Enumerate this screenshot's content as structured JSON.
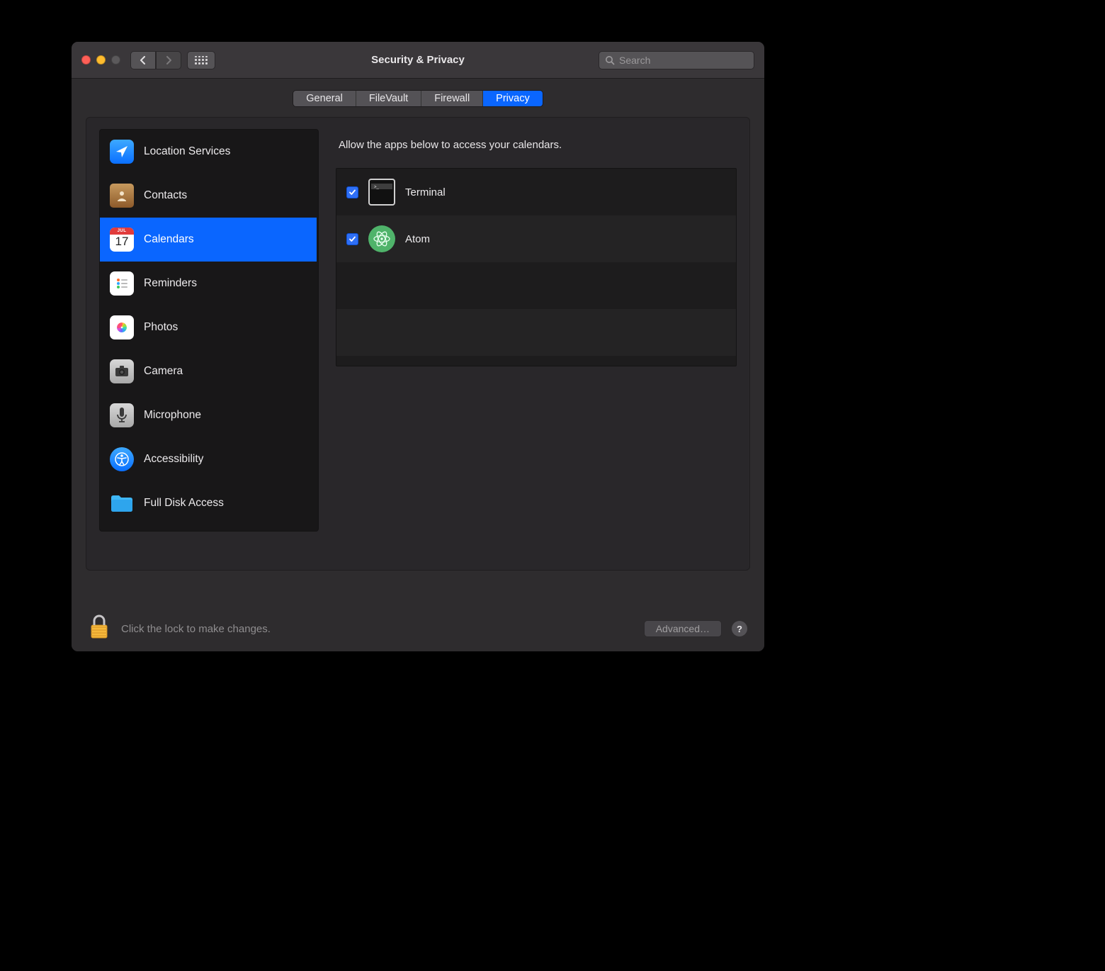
{
  "window_title": "Security & Privacy",
  "search_placeholder": "Search",
  "tabs": {
    "general": "General",
    "filevault": "FileVault",
    "firewall": "Firewall",
    "privacy": "Privacy"
  },
  "active_tab": "privacy",
  "sidebar": {
    "selected_index": 2,
    "items": [
      {
        "label": "Location Services",
        "icon": "location"
      },
      {
        "label": "Contacts",
        "icon": "contacts"
      },
      {
        "label": "Calendars",
        "icon": "calendar",
        "day": "17",
        "month": "JUL"
      },
      {
        "label": "Reminders",
        "icon": "reminders"
      },
      {
        "label": "Photos",
        "icon": "photos"
      },
      {
        "label": "Camera",
        "icon": "camera"
      },
      {
        "label": "Microphone",
        "icon": "microphone"
      },
      {
        "label": "Accessibility",
        "icon": "accessibility"
      },
      {
        "label": "Full Disk Access",
        "icon": "fulldisk"
      }
    ]
  },
  "description": "Allow the apps below to access your calendars.",
  "apps": [
    {
      "label": "Terminal",
      "checked": true,
      "icon": "terminal"
    },
    {
      "label": "Atom",
      "checked": true,
      "icon": "atom"
    }
  ],
  "lock_text": "Click the lock to make changes.",
  "advanced_label": "Advanced…",
  "help_label": "?"
}
